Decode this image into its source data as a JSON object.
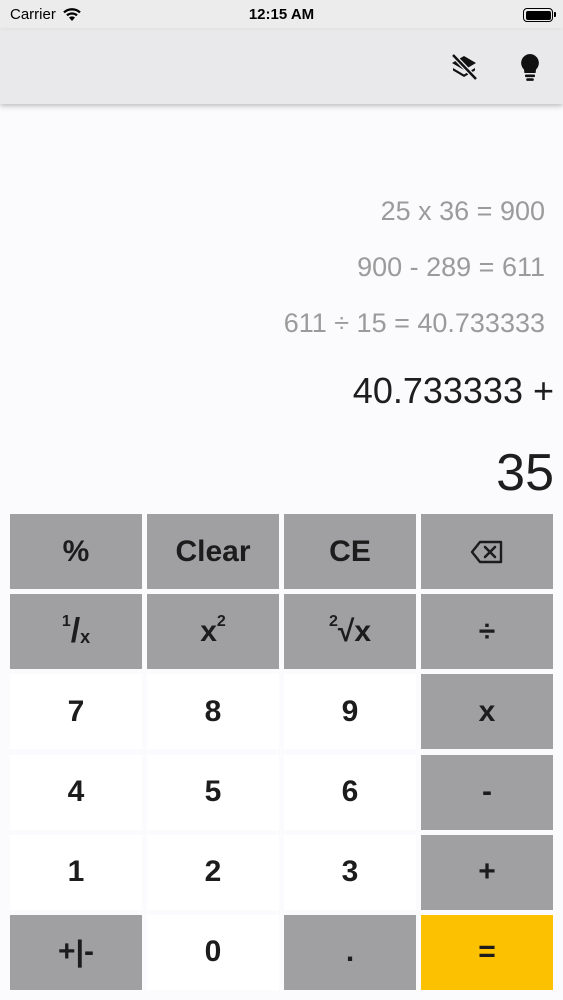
{
  "status_bar": {
    "carrier": "Carrier",
    "time": "12:15 AM"
  },
  "nav": {
    "icons": [
      "layers-off-icon",
      "lightbulb-icon"
    ]
  },
  "display": {
    "history": [
      "25 x 36 = 900",
      "900 - 289 = 611",
      "611 ÷ 15 = 40.733333"
    ],
    "expression": "40.733333 +",
    "current": "35"
  },
  "keys": {
    "percent": "%",
    "clear": "Clear",
    "ce": "CE",
    "recip_1": "1",
    "recip_slash": "/",
    "recip_x": "x",
    "square_x": "x",
    "square_exp": "2",
    "root_idx": "2",
    "root_sym": "√x",
    "divide": "÷",
    "seven": "7",
    "eight": "8",
    "nine": "9",
    "multiply": "x",
    "four": "4",
    "five": "5",
    "six": "6",
    "minus": "-",
    "one": "1",
    "two": "2",
    "three": "3",
    "plus": "+",
    "negate": "+|-",
    "zero": "0",
    "decimal": ".",
    "equals": "="
  },
  "colors": {
    "operator_key": "#a09fa2",
    "digit_key": "#ffffff",
    "equals_key": "#fcc100"
  }
}
